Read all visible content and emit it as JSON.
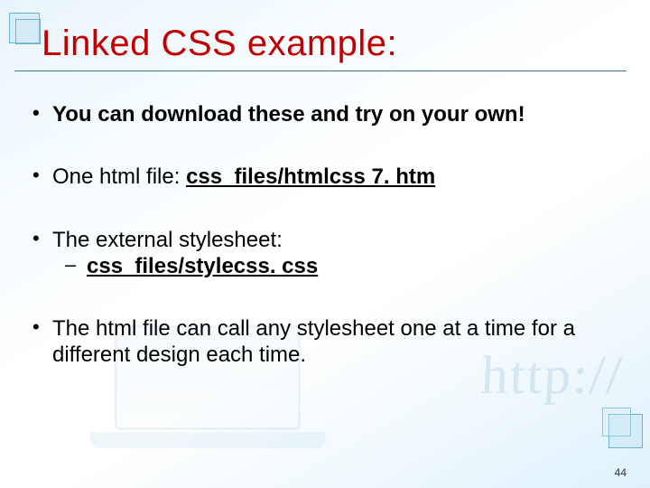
{
  "title": "Linked CSS example:",
  "bullets": {
    "b1": "You can download these and try on your own!",
    "b2_prefix": "One html file: ",
    "b2_link": "css_files/htmlcss 7. htm",
    "b3": "The external stylesheet:",
    "b3_sub_link": "css_files/stylecss. css",
    "b4": "The html file can call any stylesheet one at a time for a different design each time."
  },
  "bg_text": "http://",
  "page_number": "44"
}
